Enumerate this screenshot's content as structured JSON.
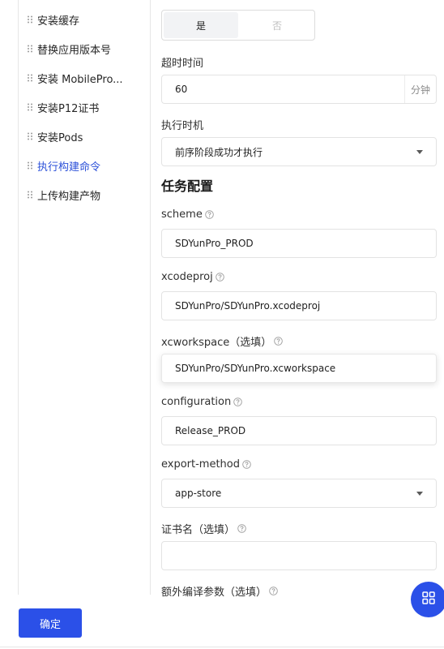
{
  "sidebar": {
    "items": [
      {
        "label": "安装缓存"
      },
      {
        "label": "替换应用版本号"
      },
      {
        "label": "安装 MobilePro..."
      },
      {
        "label": "安装P12证书"
      },
      {
        "label": "安装Pods"
      },
      {
        "label": "执行构建命令",
        "active": true
      },
      {
        "label": "上传构建产物"
      }
    ]
  },
  "form": {
    "toggle": {
      "yes": "是",
      "no": "否",
      "selected": "是"
    },
    "timeout": {
      "label": "超时时间",
      "value": "60",
      "suffix": "分钟"
    },
    "timing": {
      "label": "执行时机",
      "value": "前序阶段成功才执行"
    },
    "section_title": "任务配置",
    "scheme": {
      "label": "scheme",
      "value": "SDYunPro_PROD"
    },
    "xcodeproj": {
      "label": "xcodeproj",
      "value": "SDYunPro/SDYunPro.xcodeproj"
    },
    "xcworkspace": {
      "label": "xcworkspace（选填）",
      "value": "SDYunPro/SDYunPro.xcworkspace"
    },
    "configuration": {
      "label": "configuration",
      "value": "Release_PROD"
    },
    "export_method": {
      "label": "export-method",
      "value": "app-store"
    },
    "cert_name": {
      "label": "证书名（选填）",
      "value": ""
    },
    "extra_args": {
      "label": "额外编译参数（选填）"
    }
  },
  "footer": {
    "confirm_label": "确定"
  },
  "colors": {
    "accent": "#2b50e8",
    "active_text": "#2a4fd8"
  }
}
